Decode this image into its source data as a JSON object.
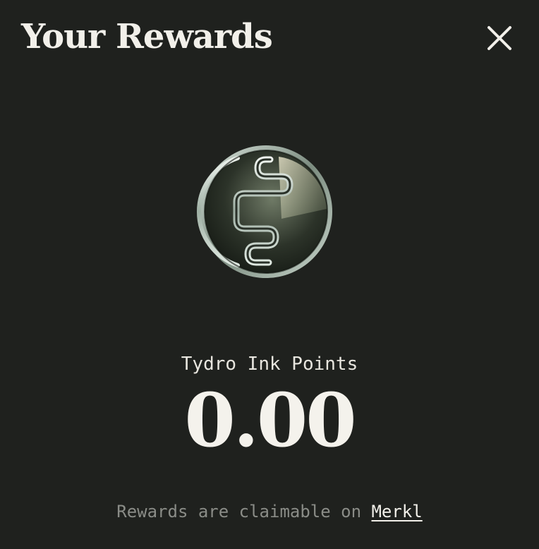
{
  "modal": {
    "title": "Your Rewards",
    "close_icon": "close-icon",
    "coin_icon": "tydro-ink-coin-icon"
  },
  "rewards": {
    "label": "Tydro Ink Points",
    "amount": "0.00"
  },
  "footer": {
    "text": "Rewards are claimable on",
    "link_label": "Merkl"
  },
  "colors": {
    "background": "#1f211e",
    "text_primary": "#f2f0ea",
    "text_muted": "#8a8c87"
  }
}
